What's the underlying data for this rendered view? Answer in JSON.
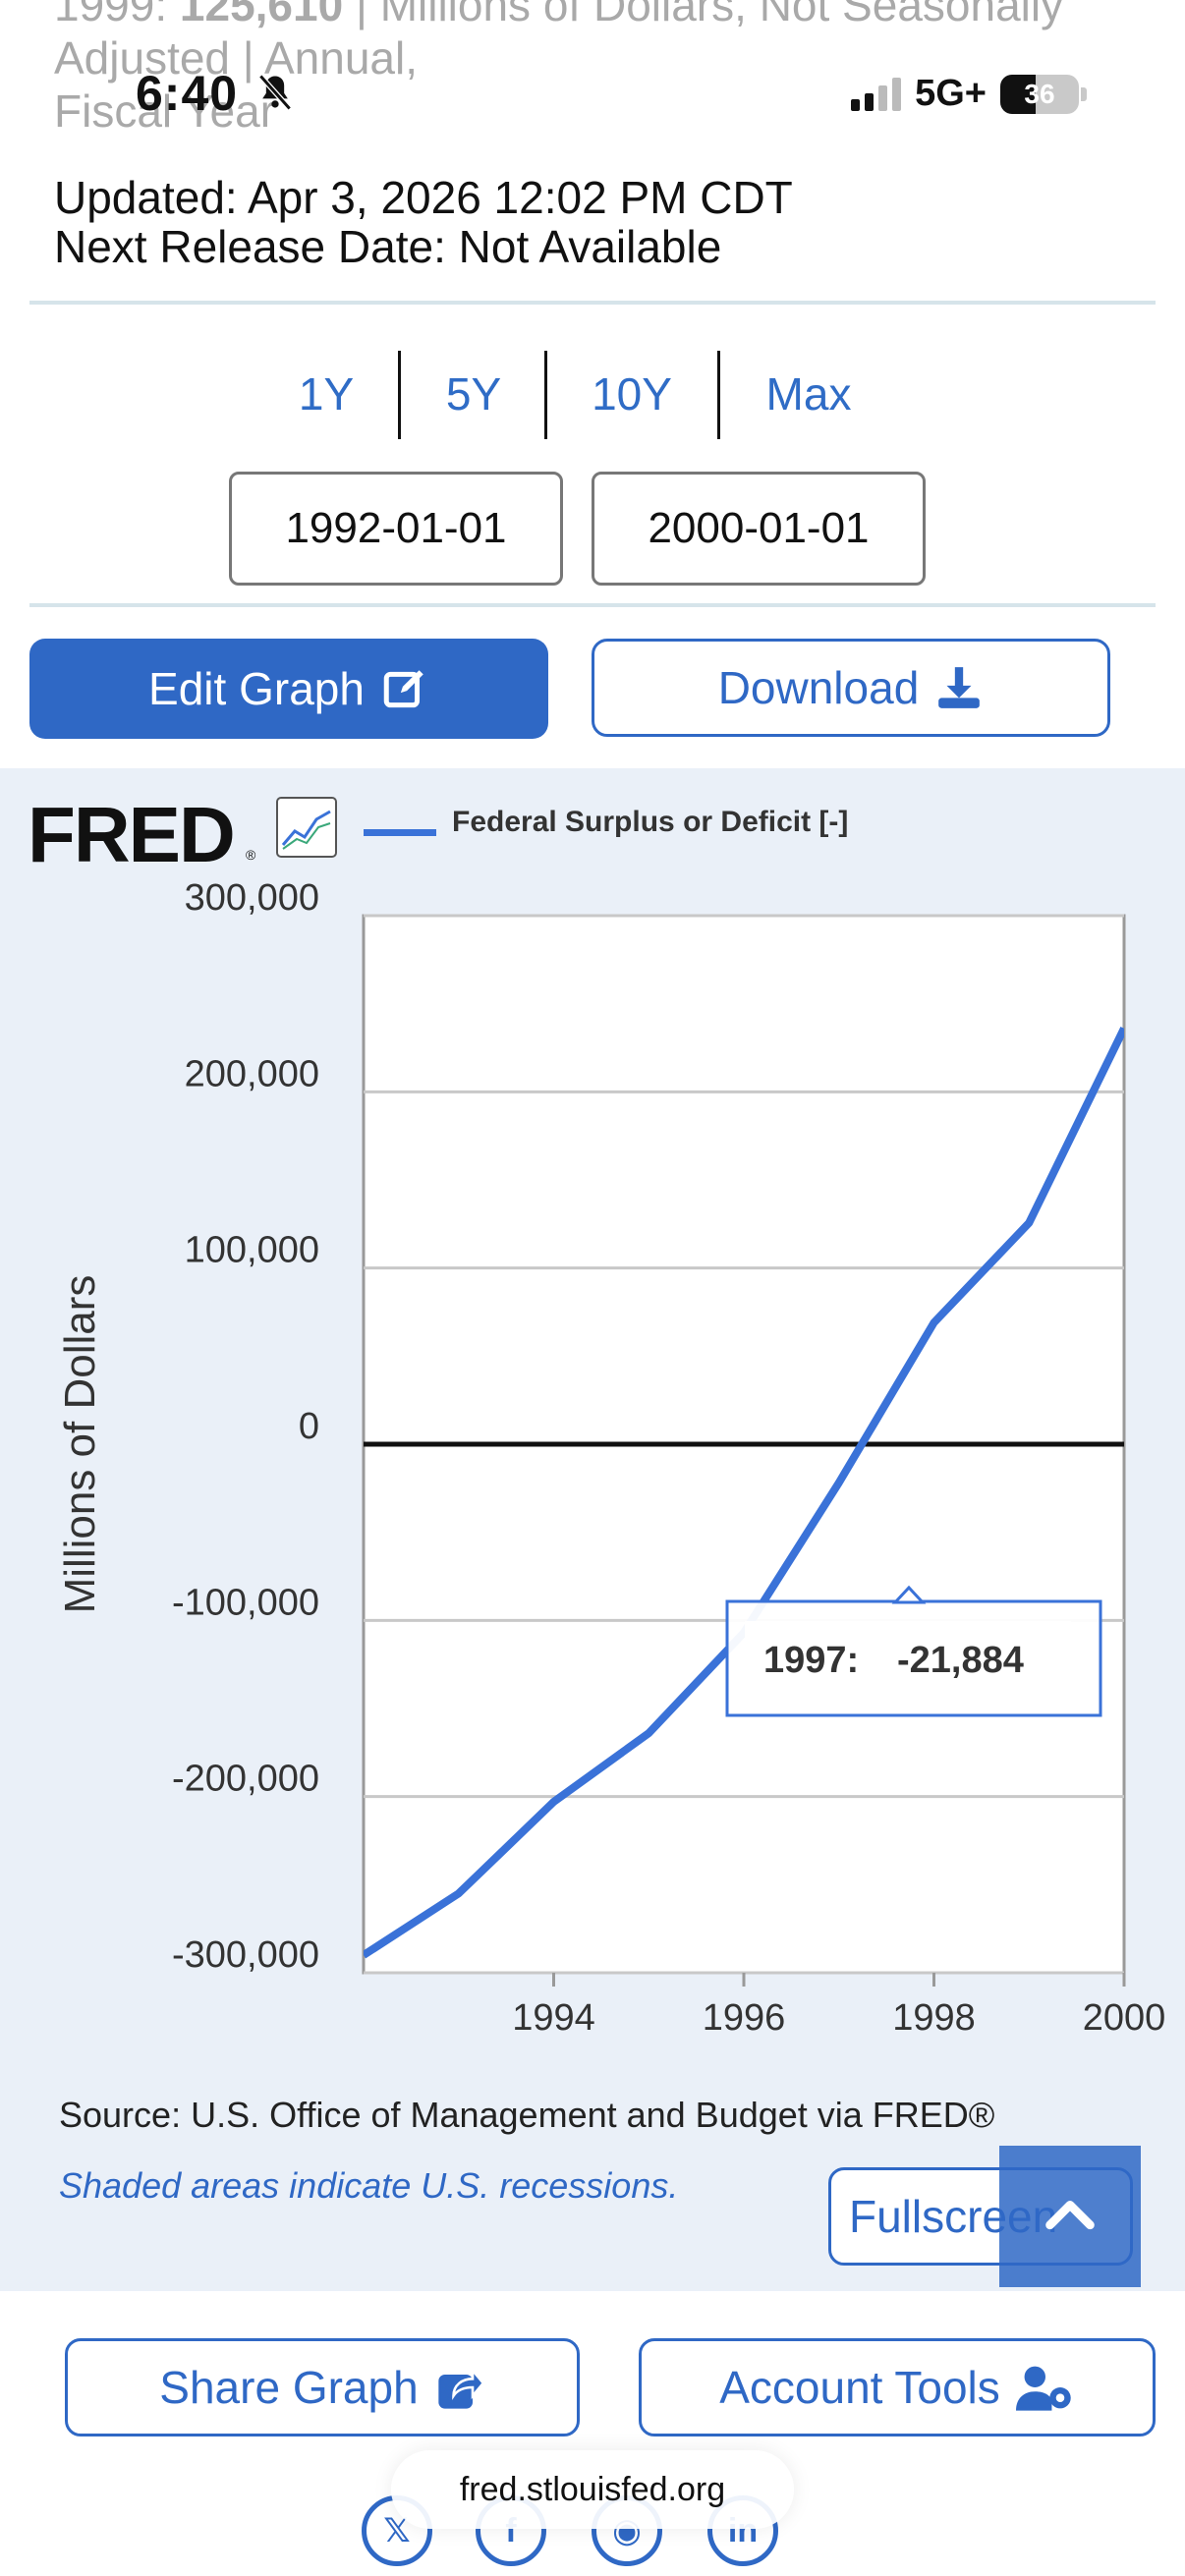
{
  "header": {
    "partial_line_1_prefix": "1999: ",
    "partial_line_1_value": "125,610",
    "partial_line_1_rest": " | Millions of Dollars, Not Seasonally",
    "partial_line_2": "Adjusted | Annual,",
    "partial_line_3": "Fiscal Year",
    "updated": "Updated: Apr 3, 2026 12:02 PM CDT",
    "next_release": "Next Release Date: Not Available"
  },
  "status_bar": {
    "time": "6:40",
    "network": "5G+",
    "battery": "36"
  },
  "ranges": [
    "1Y",
    "5Y",
    "10Y",
    "Max"
  ],
  "dates": {
    "start": "1992-01-01",
    "end": "2000-01-01"
  },
  "buttons": {
    "edit_graph": "Edit Graph",
    "download": "Download",
    "share_graph": "Share Graph",
    "account_tools": "Account Tools",
    "fullscreen": "Fullscreen"
  },
  "chart_data": {
    "type": "line",
    "logo": "FRED",
    "title": "",
    "legend": "Federal Surplus or Deficit [-]",
    "ylabel": "Millions of Dollars",
    "xlabel": "",
    "ylim": [
      -300000,
      300000
    ],
    "xlim": [
      1992,
      2000
    ],
    "yticks": [
      "300,000",
      "200,000",
      "100,000",
      "0",
      "-100,000",
      "-200,000",
      "-300,000"
    ],
    "ytick_values": [
      300000,
      200000,
      100000,
      0,
      -100000,
      -200000,
      -300000
    ],
    "xticks": [
      "1994",
      "1996",
      "1998",
      "2000"
    ],
    "xtick_values": [
      1994,
      1996,
      1998,
      2000
    ],
    "series": [
      {
        "name": "Federal Surplus or Deficit [-]",
        "color": "#3a72d8",
        "x": [
          1992,
          1993,
          1994,
          1995,
          1996,
          1997,
          1998,
          1999,
          2000
        ],
        "values": [
          -290000,
          -255000,
          -203000,
          -164000,
          -107000,
          -21884,
          69000,
          125610,
          236000
        ]
      }
    ],
    "tooltip": {
      "label": "1997:",
      "value": "-21,884",
      "x": 1997,
      "y": -21884
    },
    "grid": true
  },
  "footer": {
    "source": "Source: U.S. Office of Management and Budget via FRED®",
    "shaded": "Shaded areas indicate U.S. recessions.",
    "url": "fred.stlouisfed.org"
  }
}
